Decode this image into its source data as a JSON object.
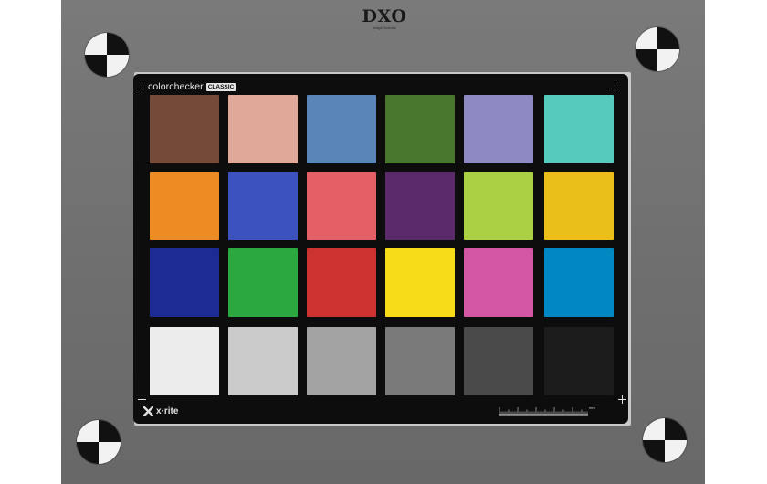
{
  "logo": {
    "main": "DXO",
    "sub": "Image Science"
  },
  "card": {
    "brand_name": "colorchecker",
    "brand_badge": "CLASSIC",
    "maker": "x·rite",
    "ruler_unit": "mm"
  },
  "patches": [
    {
      "name": "dark-skin",
      "color": "#744a38"
    },
    {
      "name": "light-skin",
      "color": "#e0a898"
    },
    {
      "name": "blue-sky",
      "color": "#5a85b8"
    },
    {
      "name": "foliage",
      "color": "#48762c"
    },
    {
      "name": "blue-flower",
      "color": "#8d8ac3"
    },
    {
      "name": "bluish-green",
      "color": "#57cbbb"
    },
    {
      "name": "orange",
      "color": "#ec8c22"
    },
    {
      "name": "purplish-blue",
      "color": "#3c52be"
    },
    {
      "name": "moderate-red",
      "color": "#e45f66"
    },
    {
      "name": "purple",
      "color": "#5a2a6b"
    },
    {
      "name": "yellow-green",
      "color": "#abd043"
    },
    {
      "name": "orange-yellow",
      "color": "#eabf19"
    },
    {
      "name": "blue",
      "color": "#1d2b95"
    },
    {
      "name": "green",
      "color": "#2ba840"
    },
    {
      "name": "red",
      "color": "#cb3230"
    },
    {
      "name": "yellow",
      "color": "#f6dd17"
    },
    {
      "name": "magenta",
      "color": "#d256a2"
    },
    {
      "name": "cyan",
      "color": "#0088c3"
    },
    {
      "name": "white",
      "color": "#ececec"
    },
    {
      "name": "neutral-8",
      "color": "#cbcbcb"
    },
    {
      "name": "neutral-6-5",
      "color": "#a3a3a3"
    },
    {
      "name": "neutral-5",
      "color": "#7a7a7a"
    },
    {
      "name": "neutral-3-5",
      "color": "#4a4a4a"
    },
    {
      "name": "black",
      "color": "#1c1c1c"
    }
  ]
}
